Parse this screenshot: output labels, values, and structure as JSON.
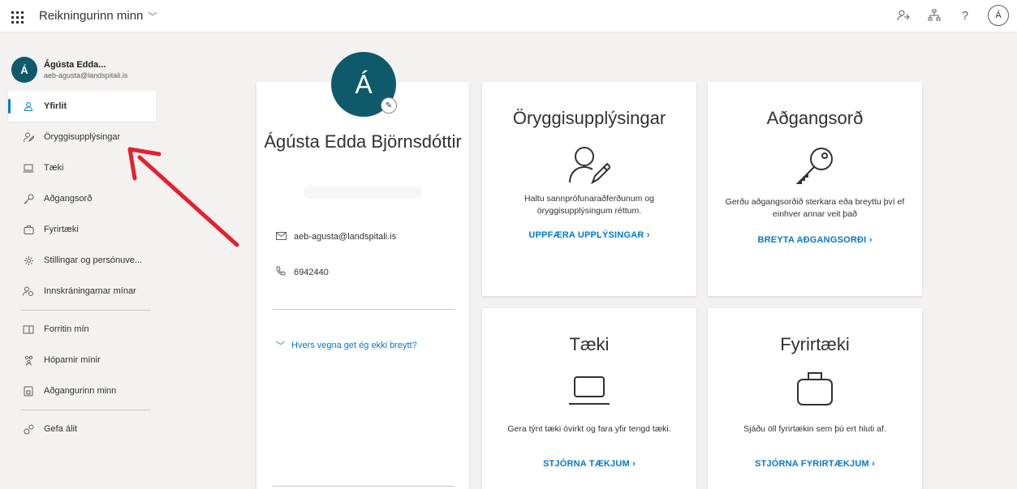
{
  "topbar": {
    "app_title": "Reikningurinn minn",
    "avatar_initial": "Á"
  },
  "sidebar": {
    "user_initial": "Á",
    "user_name": "Ágústa Edda...",
    "user_email": "aeb-agusta@landspitali.is",
    "items": [
      {
        "label": "Yfirlit",
        "icon": "person-icon"
      },
      {
        "label": "Öryggisupplýsingar",
        "icon": "security-info-icon"
      },
      {
        "label": "Tæki",
        "icon": "laptop-icon"
      },
      {
        "label": "Aðgangsorð",
        "icon": "key-icon"
      },
      {
        "label": "Fyrirtæki",
        "icon": "briefcase-icon"
      },
      {
        "label": "Stillingar og persónuve...",
        "icon": "gear-icon"
      },
      {
        "label": "Innskráningarnar mínar",
        "icon": "sign-ins-icon"
      },
      {
        "label": "Forritin mín",
        "icon": "apps-icon"
      },
      {
        "label": "Hóparnir mínir",
        "icon": "groups-icon"
      },
      {
        "label": "Aðgangurinn minn",
        "icon": "access-icon"
      },
      {
        "label": "Gefa álit",
        "icon": "feedback-icon"
      }
    ]
  },
  "profile": {
    "initial": "Á",
    "name": "Ágústa Edda Björnsdóttir",
    "email": "aeb-agusta@landspitali.is",
    "phone": "6942440",
    "why_link": "Hvers vegna get ég ekki breytt?"
  },
  "cards": {
    "security": {
      "title": "Öryggisupplýsingar",
      "desc": "Haltu sannprófunaraðferðunum og öryggisupplýsingum réttum.",
      "link": "UPPFÆRA UPPLÝSINGAR"
    },
    "password": {
      "title": "Aðgangsorð",
      "desc": "Gerðu aðgangsorðið sterkara eða breyttu því ef einhver annar veit það",
      "link": "BREYTA AÐGANGSORÐI"
    },
    "devices": {
      "title": "Tæki",
      "desc": "Gera týnt tæki óvirkt og fara yfir tengd tæki.",
      "link": "STJÓRNA TÆKJUM"
    },
    "organizations": {
      "title": "Fyrirtæki",
      "desc": "Sjáðu öll fyrirtækin sem þú ert hluti af.",
      "link": "STJÓRNA FYRIRTÆKJUM"
    }
  },
  "colors": {
    "accent": "#0078d4",
    "avatar": "#0e5a6b",
    "annotation_arrow": "#e5202e"
  }
}
